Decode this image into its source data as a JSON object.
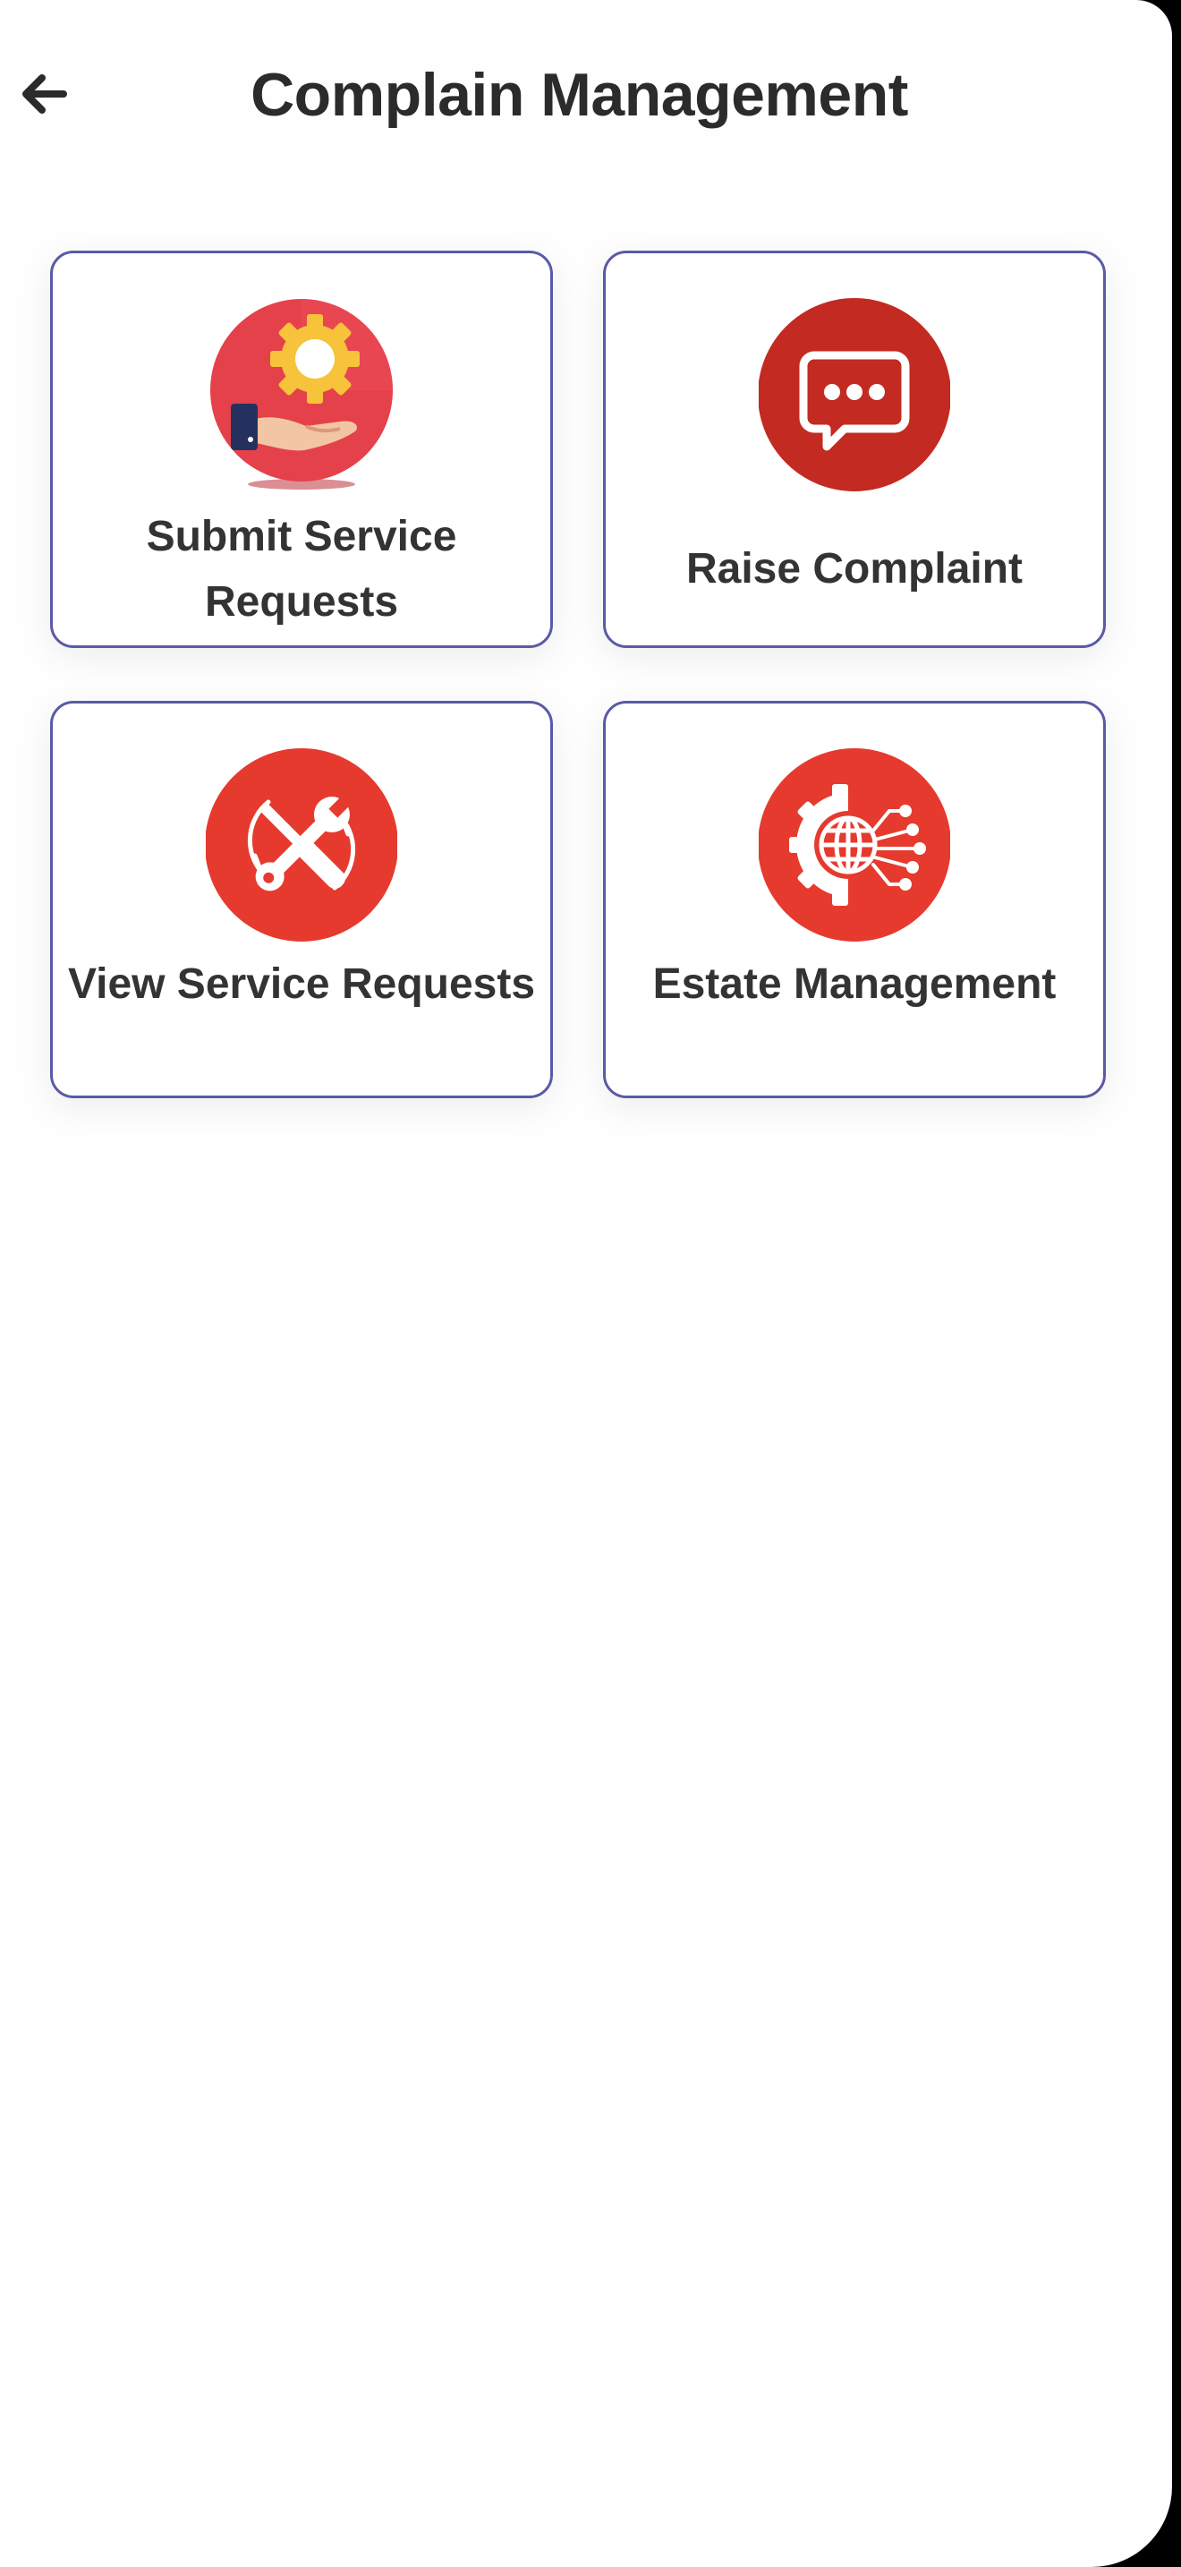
{
  "header": {
    "title": "Complain Management",
    "back_icon": "arrow-left-icon"
  },
  "tiles": [
    {
      "label": "Submit Service Requests",
      "icon": "service-gear-hand-icon"
    },
    {
      "label": "Raise Complaint",
      "icon": "chat-bubble-icon"
    },
    {
      "label": "View Service Requests",
      "icon": "wrench-screwdriver-icon"
    },
    {
      "label": "Estate Management",
      "icon": "gear-globe-network-icon"
    }
  ],
  "colors": {
    "card_border": "#5a5aa6",
    "title_text": "#2b2b2b",
    "label_text": "#333333",
    "icon_red": "#e63a2e",
    "icon_dark_red": "#c32a21",
    "icon_pink_red": "#e5414b",
    "gear_yellow": "#f6c33a"
  }
}
